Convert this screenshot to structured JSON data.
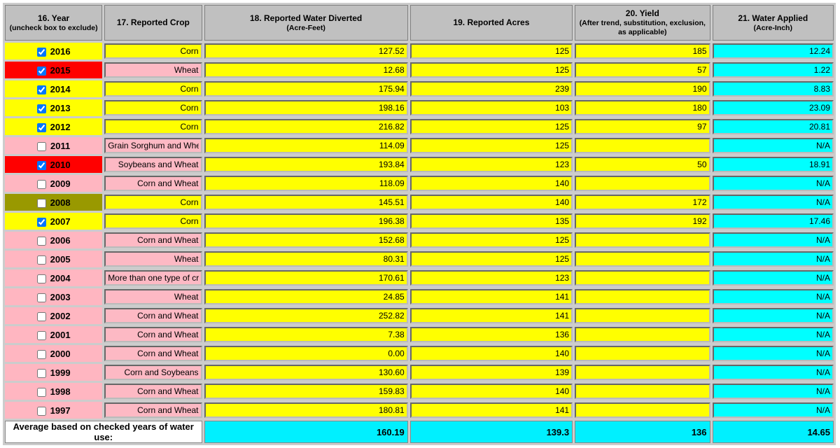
{
  "headers": {
    "year": {
      "num": "16. Year",
      "sub": "(uncheck box to exclude)"
    },
    "crop": {
      "num": "17. Reported Crop",
      "sub": ""
    },
    "water": {
      "num": "18. Reported Water Diverted",
      "sub": "(Acre-Feet)"
    },
    "acres": {
      "num": "19. Reported Acres",
      "sub": ""
    },
    "yield": {
      "num": "20. Yield",
      "sub": "(After trend, substitution, exclusion, as applicable)"
    },
    "applied": {
      "num": "21. Water Applied",
      "sub": "(Acre-Inch)"
    }
  },
  "rows": [
    {
      "year": "2016",
      "checked": true,
      "yearColor": "yellow",
      "crop": "Corn",
      "cropBg": "yellow",
      "water": "127.52",
      "acres": "125",
      "yield": "185",
      "applied": "12.24"
    },
    {
      "year": "2015",
      "checked": true,
      "yearColor": "red",
      "crop": "Wheat",
      "cropBg": "pink",
      "water": "12.68",
      "acres": "125",
      "yield": "57",
      "applied": "1.22"
    },
    {
      "year": "2014",
      "checked": true,
      "yearColor": "yellow",
      "crop": "Corn",
      "cropBg": "yellow",
      "water": "175.94",
      "acres": "239",
      "yield": "190",
      "applied": "8.83"
    },
    {
      "year": "2013",
      "checked": true,
      "yearColor": "yellow",
      "crop": "Corn",
      "cropBg": "yellow",
      "water": "198.16",
      "acres": "103",
      "yield": "180",
      "applied": "23.09"
    },
    {
      "year": "2012",
      "checked": true,
      "yearColor": "yellow",
      "crop": "Corn",
      "cropBg": "yellow",
      "water": "216.82",
      "acres": "125",
      "yield": "97",
      "applied": "20.81"
    },
    {
      "year": "2011",
      "checked": false,
      "yearColor": "pink",
      "crop": "Grain Sorghum and Wheat",
      "cropBg": "pink",
      "water": "114.09",
      "acres": "125",
      "yield": "",
      "applied": "N/A"
    },
    {
      "year": "2010",
      "checked": true,
      "yearColor": "red",
      "crop": "Soybeans and Wheat",
      "cropBg": "pink",
      "water": "193.84",
      "acres": "123",
      "yield": "50",
      "applied": "18.91"
    },
    {
      "year": "2009",
      "checked": false,
      "yearColor": "pink",
      "crop": "Corn and Wheat",
      "cropBg": "pink",
      "water": "118.09",
      "acres": "140",
      "yield": "",
      "applied": "N/A"
    },
    {
      "year": "2008",
      "checked": false,
      "yearColor": "olive",
      "crop": "Corn",
      "cropBg": "yellow",
      "water": "145.51",
      "acres": "140",
      "yield": "172",
      "applied": "N/A"
    },
    {
      "year": "2007",
      "checked": true,
      "yearColor": "yellow",
      "crop": "Corn",
      "cropBg": "yellow",
      "water": "196.38",
      "acres": "135",
      "yield": "192",
      "applied": "17.46"
    },
    {
      "year": "2006",
      "checked": false,
      "yearColor": "pink",
      "crop": "Corn and Wheat",
      "cropBg": "pink",
      "water": "152.68",
      "acres": "125",
      "yield": "",
      "applied": "N/A"
    },
    {
      "year": "2005",
      "checked": false,
      "yearColor": "pink",
      "crop": "Wheat",
      "cropBg": "pink",
      "water": "80.31",
      "acres": "125",
      "yield": "",
      "applied": "N/A"
    },
    {
      "year": "2004",
      "checked": false,
      "yearColor": "pink",
      "crop": "More than one type of crop",
      "cropBg": "pink",
      "water": "170.61",
      "acres": "123",
      "yield": "",
      "applied": "N/A"
    },
    {
      "year": "2003",
      "checked": false,
      "yearColor": "pink",
      "crop": "Wheat",
      "cropBg": "pink",
      "water": "24.85",
      "acres": "141",
      "yield": "",
      "applied": "N/A"
    },
    {
      "year": "2002",
      "checked": false,
      "yearColor": "pink",
      "crop": "Corn and Wheat",
      "cropBg": "pink",
      "water": "252.82",
      "acres": "141",
      "yield": "",
      "applied": "N/A"
    },
    {
      "year": "2001",
      "checked": false,
      "yearColor": "pink",
      "crop": "Corn and Wheat",
      "cropBg": "pink",
      "water": "7.38",
      "acres": "136",
      "yield": "",
      "applied": "N/A"
    },
    {
      "year": "2000",
      "checked": false,
      "yearColor": "pink",
      "crop": "Corn and Wheat",
      "cropBg": "pink",
      "water": "0.00",
      "acres": "140",
      "yield": "",
      "applied": "N/A"
    },
    {
      "year": "1999",
      "checked": false,
      "yearColor": "pink",
      "crop": "Corn and Soybeans",
      "cropBg": "pink",
      "water": "130.60",
      "acres": "139",
      "yield": "",
      "applied": "N/A"
    },
    {
      "year": "1998",
      "checked": false,
      "yearColor": "pink",
      "crop": "Corn and Wheat",
      "cropBg": "pink",
      "water": "159.83",
      "acres": "140",
      "yield": "",
      "applied": "N/A"
    },
    {
      "year": "1997",
      "checked": false,
      "yearColor": "pink",
      "crop": "Corn and Wheat",
      "cropBg": "pink",
      "water": "180.81",
      "acres": "141",
      "yield": "",
      "applied": "N/A"
    }
  ],
  "average": {
    "label": "Average based on checked years of water use:",
    "water": "160.19",
    "acres": "139.3",
    "yield": "136",
    "applied": "14.65"
  }
}
